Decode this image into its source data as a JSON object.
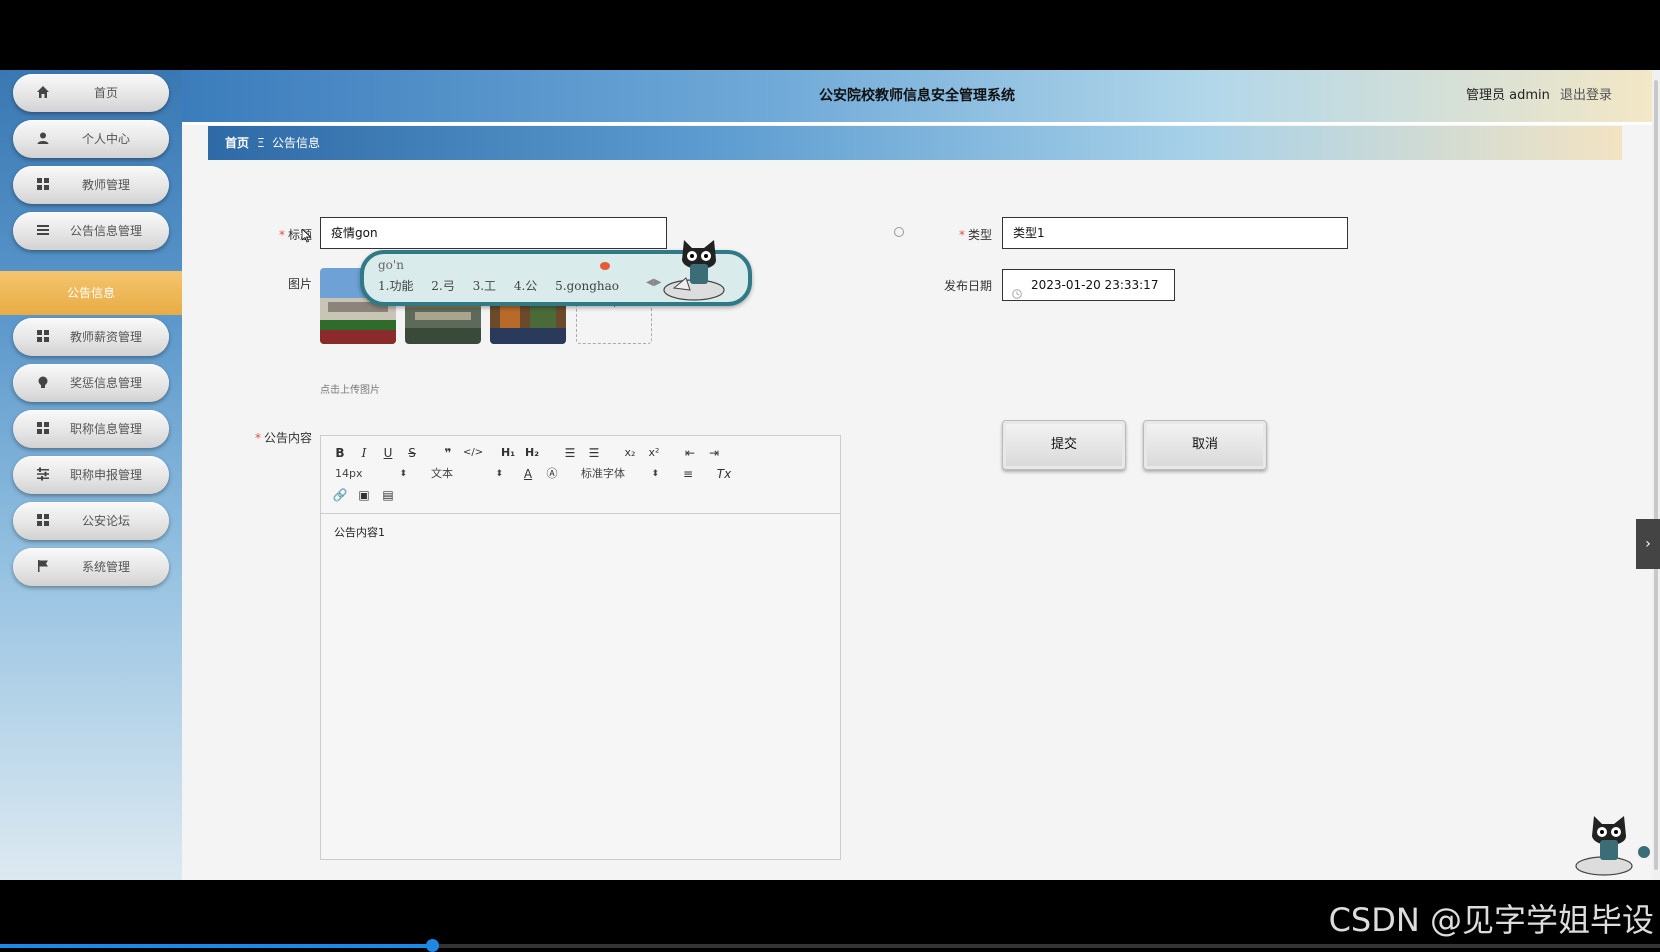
{
  "header": {
    "title": "公安院校教师信息安全管理系统",
    "user": "管理员 admin",
    "logout": "退出登录"
  },
  "sidebar": {
    "items": [
      {
        "label": "首页",
        "icon": "home-icon"
      },
      {
        "label": "个人中心",
        "icon": "user-icon"
      },
      {
        "label": "教师管理",
        "icon": "grid-icon"
      },
      {
        "label": "公告信息管理",
        "icon": "list-icon"
      },
      {
        "label": "教师薪资管理",
        "icon": "grid-icon"
      },
      {
        "label": "奖惩信息管理",
        "icon": "bulb-icon"
      },
      {
        "label": "职称信息管理",
        "icon": "grid-icon"
      },
      {
        "label": "职称申报管理",
        "icon": "sliders-icon"
      },
      {
        "label": "公安论坛",
        "icon": "grid-icon"
      },
      {
        "label": "系统管理",
        "icon": "flag-icon"
      }
    ],
    "active_sub": "公告信息"
  },
  "breadcrumb": {
    "home": "首页",
    "sep": "Ξ",
    "current": "公告信息"
  },
  "form": {
    "title_label": "标题",
    "title_value": "疫情gon",
    "type_label": "类型",
    "type_value": "类型1",
    "image_label": "图片",
    "upload_hint": "点击上传图片",
    "date_label": "发布日期",
    "date_value": "2023-01-20 23:33:17",
    "content_label": "公告内容",
    "content_value": "公告内容1",
    "submit": "提交",
    "cancel": "取消"
  },
  "editor": {
    "font_size": "14px",
    "block_type": "文本",
    "font_family": "标准字体"
  },
  "ime": {
    "composition": "go'n",
    "candidates": [
      "1.功能",
      "2.弓",
      "3.工",
      "4.公",
      "5.gonghao"
    ]
  },
  "watermark": "CSDN @见字学姐毕设",
  "video_progress": 0.26
}
